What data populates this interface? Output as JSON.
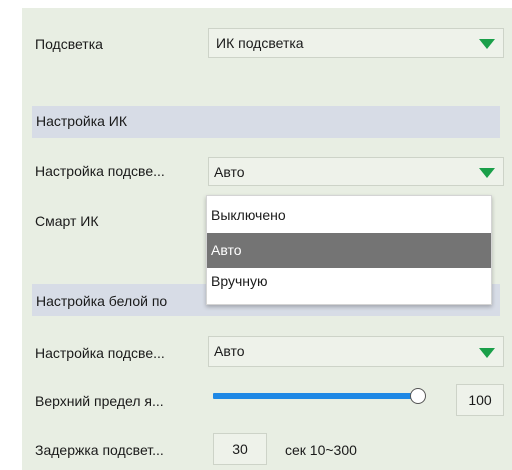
{
  "fields": {
    "backlight": {
      "label": "Подсветка",
      "value": "ИК подсветка"
    },
    "ir_section": {
      "title": "Настройка ИК"
    },
    "ir_backlight_setting": {
      "label": "Настройка подсве...",
      "value": "Авто"
    },
    "smart_ir": {
      "label": "Смарт ИК"
    },
    "white_section": {
      "title_visible": "Настройка белой по"
    },
    "white_backlight_setting": {
      "label": "Настройка подсве...",
      "value": "Авто"
    },
    "brightness_upper_limit": {
      "label": "Верхний предел я...",
      "value": "100",
      "level": 1.0
    },
    "backlight_delay": {
      "label": "Задержка подсвет...",
      "value": "30",
      "unit_range": "сек 10~300"
    }
  },
  "dropdown": {
    "options": [
      "Выключено",
      "Авто",
      "Вручную"
    ],
    "selected": "Авто"
  },
  "colors": {
    "accent": "#1a9f49",
    "slider": "#1e88e5",
    "selected_option_bg": "#747474",
    "section_bg": "#d7dce6"
  },
  "icons": {
    "dropdown_arrow": "chevron-down-icon"
  }
}
